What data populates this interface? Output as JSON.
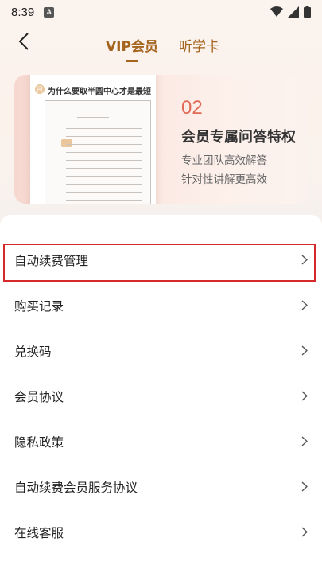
{
  "status_bar": {
    "time": "8:39",
    "notification_glyph": "A",
    "icons": [
      "wifi-icon",
      "signal-icon",
      "battery-icon"
    ]
  },
  "nav": {
    "tabs": [
      {
        "label": "VIP会员",
        "active": true
      },
      {
        "label": "听学卡",
        "active": false
      }
    ],
    "accent_color": "#a5641d"
  },
  "banner": {
    "doc_title": "为什么要取半圆中心才是最短",
    "number": "02",
    "title": "会员专属问答特权",
    "subtitles": [
      "专业团队高效解答",
      "针对性讲解更高效"
    ]
  },
  "menu": {
    "items": [
      {
        "label": "自动续费管理",
        "highlighted": true
      },
      {
        "label": "购买记录"
      },
      {
        "label": "兑换码"
      },
      {
        "label": "会员协议"
      },
      {
        "label": "隐私政策"
      },
      {
        "label": "自动续费会员服务协议"
      },
      {
        "label": "在线客服"
      }
    ],
    "highlight_color": "#d62a2a"
  }
}
